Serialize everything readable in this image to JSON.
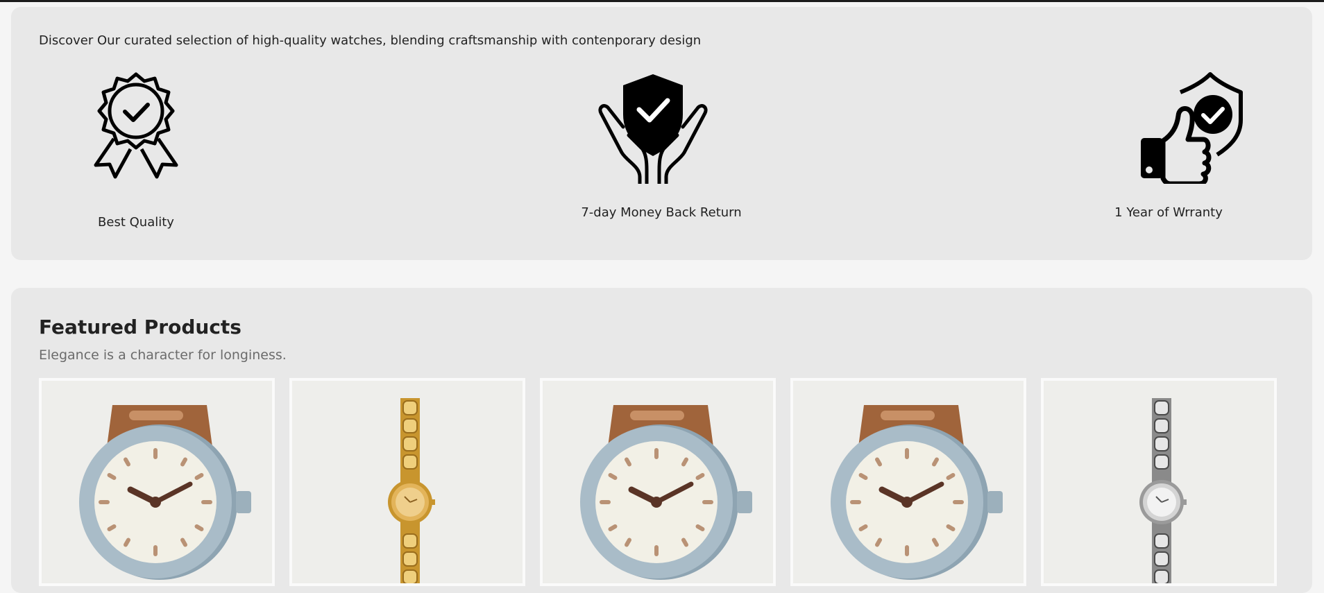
{
  "features_section": {
    "intro": "Discover Our curated selection of high-quality watches, blending craftsmanship with contenporary design",
    "items": [
      {
        "label": "Best Quality",
        "icon": "award-badge-icon"
      },
      {
        "label": "7-day Money Back Return",
        "icon": "shield-hands-icon"
      },
      {
        "label": "1 Year of Wrranty",
        "icon": "thumbs-up-shield-icon"
      }
    ]
  },
  "featured": {
    "title": "Featured Products",
    "subtitle": "Elegance is a character for longiness.",
    "products": [
      {
        "image": "brown-strap-watch"
      },
      {
        "image": "gold-chain-watch"
      },
      {
        "image": "brown-strap-watch"
      },
      {
        "image": "brown-strap-watch"
      },
      {
        "image": "silver-chain-watch"
      }
    ]
  },
  "colors": {
    "page_bg": "#f5f5f5",
    "panel_bg": "#e8e8e8",
    "card_bg": "#eeeeeb",
    "strap_brown": "#a0643b",
    "case_blue": "#a9bcc8",
    "gold": "#d7a941",
    "silver": "#c8c8c8"
  }
}
